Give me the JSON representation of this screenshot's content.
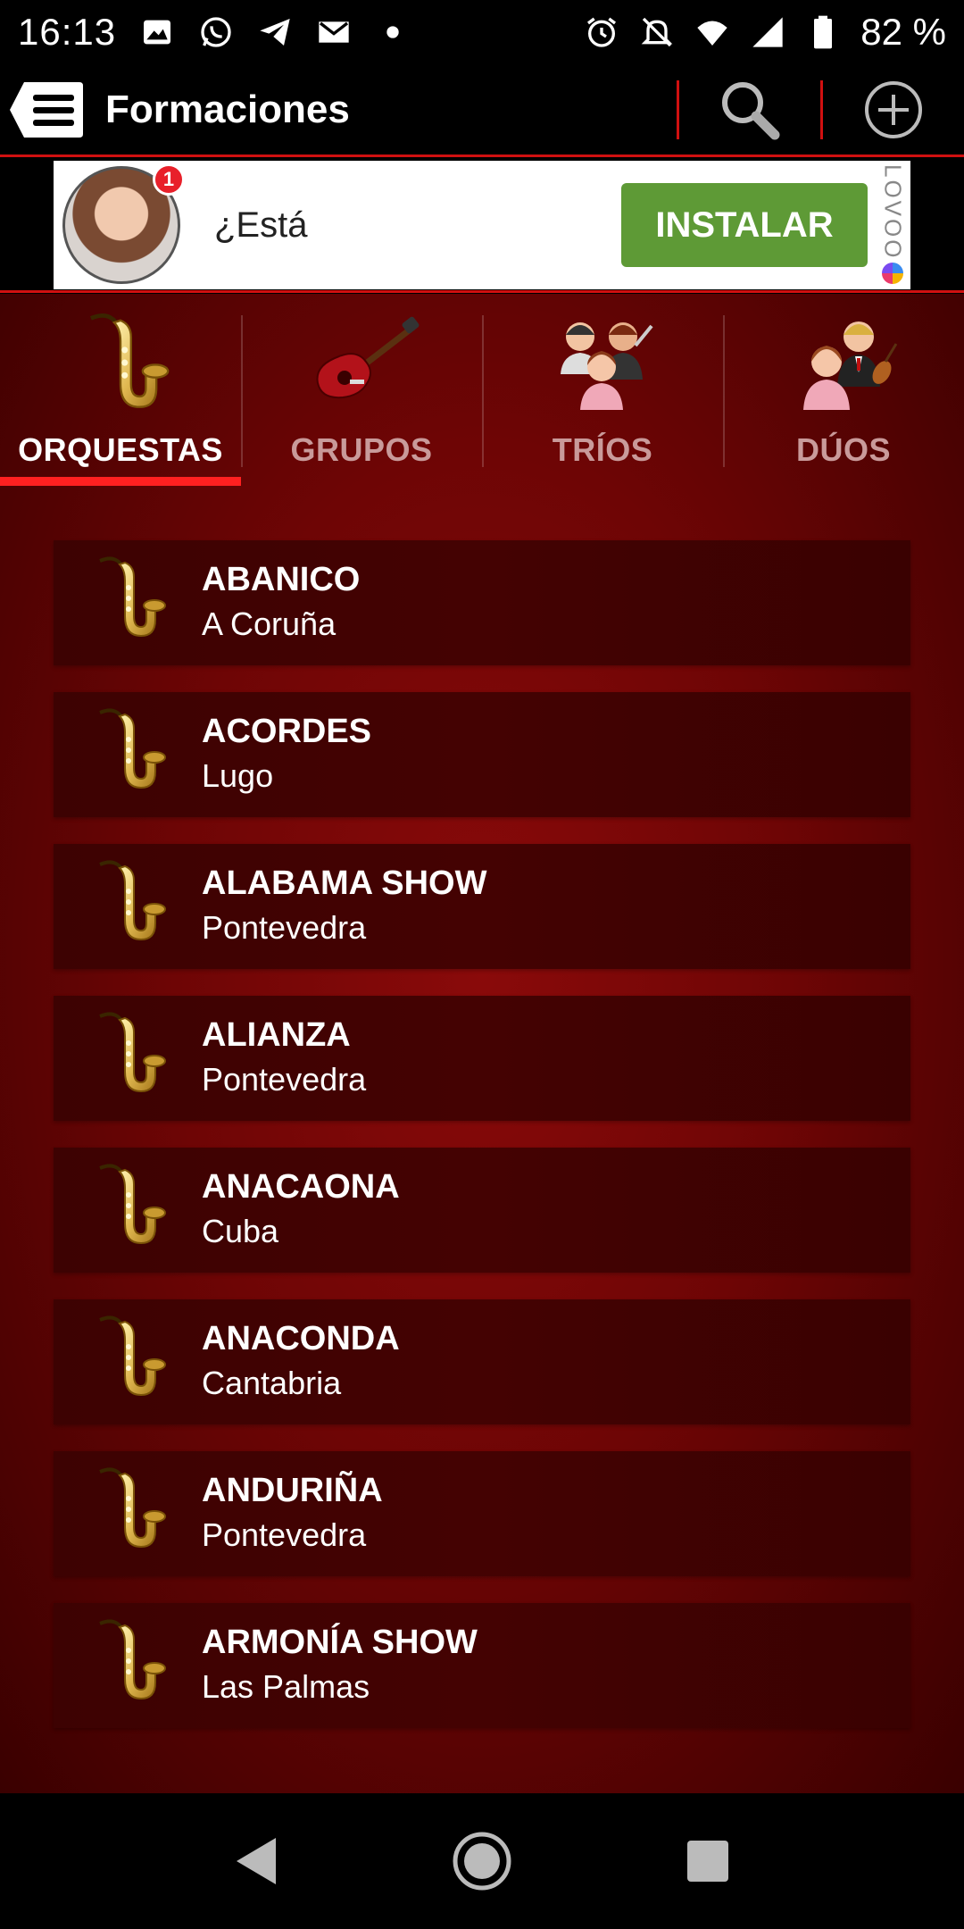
{
  "status_bar": {
    "time": "16:13",
    "battery": "82 %",
    "left_icons": [
      "image-icon",
      "whatsapp-icon",
      "telegram-icon",
      "gmail-icon",
      "dot-icon"
    ],
    "right_icons": [
      "alarm-icon",
      "notifications-off-icon",
      "wifi-icon",
      "signal-icon",
      "battery-icon"
    ]
  },
  "app_bar": {
    "title": "Formaciones"
  },
  "ad": {
    "badge": "1",
    "text": "¿Está",
    "button": "INSTALAR",
    "brand": "LOVOO"
  },
  "tabs": [
    {
      "label": "ORQUESTAS",
      "icon": "saxophone-icon",
      "active": true
    },
    {
      "label": "GRUPOS",
      "icon": "guitar-icon",
      "active": false
    },
    {
      "label": "TRÍOS",
      "icon": "trio-icon",
      "active": false
    },
    {
      "label": "DÚOS",
      "icon": "duo-icon",
      "active": false
    }
  ],
  "list": [
    {
      "name": "ABANICO",
      "location": "A Coruña"
    },
    {
      "name": "ACORDES",
      "location": "Lugo"
    },
    {
      "name": "ALABAMA SHOW",
      "location": "Pontevedra"
    },
    {
      "name": "ALIANZA",
      "location": "Pontevedra"
    },
    {
      "name": "ANACAONA",
      "location": "Cuba"
    },
    {
      "name": "ANACONDA",
      "location": "Cantabria"
    },
    {
      "name": "ANDURIÑA",
      "location": "Pontevedra"
    },
    {
      "name": "ARMONÍA SHOW",
      "location": "Las Palmas"
    }
  ],
  "colors": {
    "accent": "#d01010",
    "tab_underline": "#ff2020",
    "install_button": "#5e9a36",
    "background_red": "#6e0505"
  }
}
